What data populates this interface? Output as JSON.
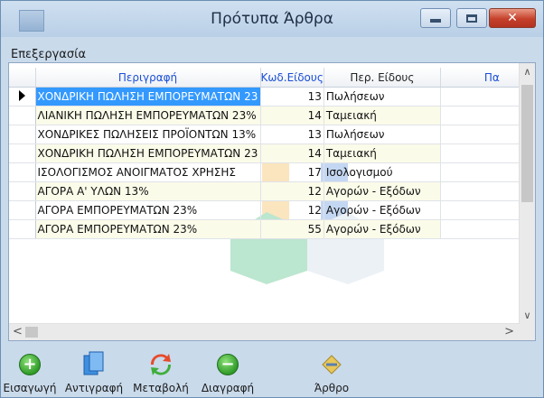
{
  "window": {
    "title": "Πρότυπα Άρθρα",
    "close_glyph": "✕"
  },
  "menu": {
    "items": [
      "Επεξεργασία"
    ]
  },
  "grid": {
    "columns": {
      "description": "Περιγραφή",
      "code": "Κωδ.Είδους",
      "type": "Περ. Είδους",
      "extra": "Πα"
    },
    "rows": [
      {
        "description": "ΧΟΝΔΡΙΚΗ ΠΩΛΗΣΗ ΕΜΠΟΡΕΥΜΑΤΩΝ 23",
        "code": "13",
        "type": "Πωλήσεων"
      },
      {
        "description": "ΛΙΑΝΙΚΗ ΠΩΛΗΣΗ ΕΜΠΟΡΕΥΜΑΤΩΝ 23%",
        "code": "14",
        "type": "Ταμειακή"
      },
      {
        "description": "ΧΟΝΔΡΙΚΕΣ ΠΩΛΗΣΕΙΣ ΠΡΟΪΟΝΤΩΝ 13%",
        "code": "13",
        "type": "Πωλήσεων"
      },
      {
        "description": "ΧΟΝΔΡΙΚΗ ΠΩΛΗΣΗ ΕΜΠΟΡΕΥΜΑΤΩΝ 23",
        "code": "14",
        "type": "Ταμειακή"
      },
      {
        "description": "ΙΣΟΛΟΓΙΣΜΟΣ ΑΝΟΙΓΜΑΤΟΣ ΧΡΗΣΗΣ",
        "code": "17",
        "type": "Ισολογισμού"
      },
      {
        "description": "ΑΓΟΡΑ Α' ΥΛΩΝ 13%",
        "code": "12",
        "type": "Αγορών - Εξόδων"
      },
      {
        "description": "ΑΓΟΡΑ ΕΜΠΟΡΕΥΜΑΤΩΝ 23%",
        "code": "12",
        "type": "Αγορών - Εξόδων"
      },
      {
        "description": "ΑΓΟΡΑ ΕΜΠΟΡΕΥΜΑΤΩΝ 23%",
        "code": "55",
        "type": "Αγορών - Εξόδων"
      }
    ],
    "selected_row": 0
  },
  "toolbar": {
    "insert": "Εισαγωγή",
    "copy": "Αντιγραφή",
    "modify": "Μεταβολή",
    "delete": "Διαγραφή",
    "article": "Άρθρο"
  },
  "icons": [
    "app-icon",
    "plus-circle-icon",
    "copy-pages-icon",
    "refresh-arrows-icon",
    "minus-circle-icon",
    "pencil-article-icon"
  ]
}
